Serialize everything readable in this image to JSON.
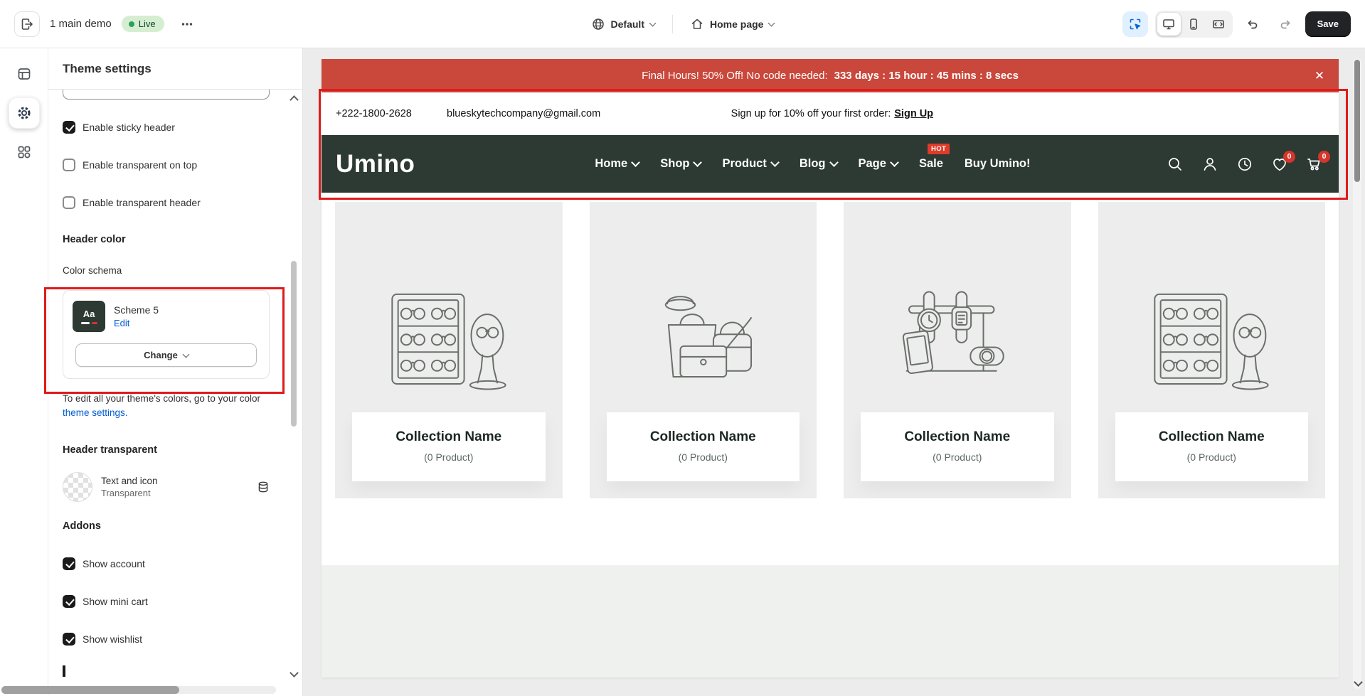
{
  "topbar": {
    "store_name": "1 main demo",
    "live_badge": "Live",
    "language_selector": "Default",
    "page_selector": "Home page",
    "save_label": "Save"
  },
  "panel": {
    "title": "Theme settings",
    "checkboxes": [
      {
        "label": "Enable sticky header",
        "checked": true
      },
      {
        "label": "Enable transparent on top",
        "checked": false
      },
      {
        "label": "Enable transparent header",
        "checked": false
      }
    ],
    "header_color_heading": "Header color",
    "color_schema_label": "Color schema",
    "scheme": {
      "swatch_text": "Aa",
      "name": "Scheme 5",
      "edit_label": "Edit",
      "change_label": "Change"
    },
    "note_prefix": "To edit all your theme's colors, go to your color ",
    "note_link": "theme settings.",
    "header_transparent_heading": "Header transparent",
    "transparent_row": {
      "label": "Text and icon",
      "value": "Transparent"
    },
    "addons_heading": "Addons",
    "addons": [
      {
        "label": "Show account",
        "checked": true
      },
      {
        "label": "Show mini cart",
        "checked": true
      },
      {
        "label": "Show wishlist",
        "checked": true
      }
    ]
  },
  "preview": {
    "announcement": {
      "text": "Final Hours! 50% Off! No code needed:",
      "countdown": "333 days : 15 hour : 45 mins : 8 secs"
    },
    "topstrip": {
      "phone": "+222-1800-2628",
      "email": "blueskytechcompany@gmail.com",
      "signup_text": "Sign up for 10% off your first order:",
      "signup_link": "Sign Up"
    },
    "header": {
      "logo": "Umino",
      "nav": [
        {
          "label": "Home"
        },
        {
          "label": "Shop"
        },
        {
          "label": "Product"
        },
        {
          "label": "Blog"
        },
        {
          "label": "Page"
        },
        {
          "label": "Sale",
          "badge": "HOT"
        },
        {
          "label": "Buy Umino!"
        }
      ],
      "wishlist_count": "0",
      "cart_count": "0"
    },
    "collections": [
      {
        "name": "Collection Name",
        "count": "(0 Product)",
        "illustration": "glasses-display",
        "ill_ref": "#ill-glasses"
      },
      {
        "name": "Collection Name",
        "count": "(0 Product)",
        "illustration": "handbags",
        "ill_ref": "#ill-bags"
      },
      {
        "name": "Collection Name",
        "count": "(0 Product)",
        "illustration": "watches",
        "ill_ref": "#ill-watches"
      },
      {
        "name": "Collection Name",
        "count": "(0 Product)",
        "illustration": "glasses-display",
        "ill_ref": "#ill-glasses"
      }
    ]
  },
  "colors": {
    "accent_blue": "#005bd3",
    "announcement_red": "#c9473b",
    "store_header_green": "#2d3a33",
    "annotation_red": "#e01a1a",
    "badge_red": "#d6352b",
    "live_green_bg": "#d5eed2",
    "save_button_black": "#222326"
  }
}
